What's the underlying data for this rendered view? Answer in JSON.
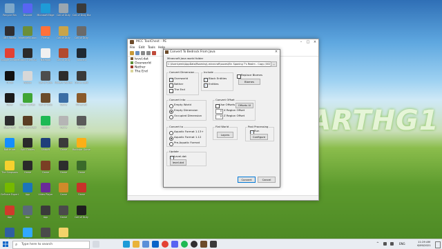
{
  "desktop": {
    "wallpaper_text": "EARTHG1",
    "icons": [
      {
        "label": "Recycle Bin",
        "icon": "recycle-bin-icon",
        "color": "#7da7c9",
        "col": 0,
        "row": 0
      },
      {
        "label": "Discord",
        "icon": "discord-icon",
        "color": "#5865f2",
        "col": 1,
        "row": 0
      },
      {
        "label": "Microsoft Edge",
        "icon": "edge-icon",
        "color": "#1e9bd7",
        "col": 2,
        "row": 0
      },
      {
        "label": "Call of Duty",
        "icon": "game-icon",
        "color": "#9aa6b0",
        "col": 3,
        "row": 0
      },
      {
        "label": "Call of Duty Black Ops",
        "icon": "game-icon",
        "color": "#3a3a3a",
        "col": 4,
        "row": 0
      },
      {
        "label": "OBS Studio",
        "icon": "obs-icon",
        "color": "#302e31",
        "col": 0,
        "row": 1
      },
      {
        "label": "Minecraft Launcher",
        "icon": "minecraft-icon",
        "color": "#6b8e3a",
        "col": 1,
        "row": 1
      },
      {
        "label": "Firefox",
        "icon": "firefox-icon",
        "color": "#ff7139",
        "col": 2,
        "row": 1
      },
      {
        "label": "Call of Duty",
        "icon": "game-icon",
        "color": "#c9a44a",
        "col": 3,
        "row": 1
      },
      {
        "label": "Call of Duty",
        "icon": "game-icon",
        "color": "#6a6a6a",
        "col": 4,
        "row": 1
      },
      {
        "label": "Google Chrome",
        "icon": "chrome-icon",
        "color": "#e34133",
        "col": 0,
        "row": 2
      },
      {
        "label": "Grand Theft Auto V",
        "icon": "gta-icon",
        "color": "#2b2b2b",
        "col": 1,
        "row": 2
      },
      {
        "label": "Notepad",
        "icon": "file-icon",
        "color": "#f0f0f0",
        "col": 2,
        "row": 2
      },
      {
        "label": "Call of Duty",
        "icon": "game-icon",
        "color": "#b24a2e",
        "col": 3,
        "row": 2
      },
      {
        "label": "Valorant",
        "icon": "game-icon",
        "color": "#1f2933",
        "col": 4,
        "row": 2
      },
      {
        "label": "TikTok",
        "icon": "tiktok-icon",
        "color": "#111111",
        "col": 0,
        "row": 3
      },
      {
        "label": "Roblox",
        "icon": "roblox-icon",
        "color": "#d8d8d8",
        "col": 1,
        "row": 3
      },
      {
        "label": "Call of Duty",
        "icon": "game-icon",
        "color": "#4d4d4d",
        "col": 2,
        "row": 3
      },
      {
        "label": "Modern Warfare",
        "icon": "game-icon",
        "color": "#2c2c2c",
        "col": 3,
        "row": 3
      },
      {
        "label": "Dying Light",
        "icon": "game-icon",
        "color": "#3a3a3a",
        "col": 4,
        "row": 3
      },
      {
        "label": "Razer",
        "icon": "razer-icon",
        "color": "#1b1b1b",
        "col": 0,
        "row": 4
      },
      {
        "label": "Razer Cortex",
        "icon": "razer-icon",
        "color": "#3fa535",
        "col": 1,
        "row": 4
      },
      {
        "label": "Call of Duty",
        "icon": "game-icon",
        "color": "#6b4c2b",
        "col": 2,
        "row": 4
      },
      {
        "label": "Game",
        "icon": "game-icon",
        "color": "#3b6ea5",
        "col": 3,
        "row": 4
      },
      {
        "label": "Minecraft",
        "icon": "minecraft-icon",
        "color": "#8a5a2b",
        "col": 4,
        "row": 4
      },
      {
        "label": "Steel Rain",
        "icon": "game-icon",
        "color": "#2d2d2d",
        "col": 0,
        "row": 5
      },
      {
        "label": "MCC ToolChest",
        "icon": "tool-icon",
        "color": "#5a3d22",
        "col": 1,
        "row": 5
      },
      {
        "label": "Spotify",
        "icon": "spotify-icon",
        "color": "#1db954",
        "col": 2,
        "row": 5
      },
      {
        "label": "Game",
        "icon": "game-icon",
        "color": "#b5b5b5",
        "col": 3,
        "row": 5
      },
      {
        "label": "Game",
        "icon": "game-icon",
        "color": "#5a5a5a",
        "col": 4,
        "row": 5
      },
      {
        "label": "Battle.net",
        "icon": "battlenet-icon",
        "color": "#148eff",
        "col": 0,
        "row": 6
      },
      {
        "label": "Epic Games",
        "icon": "epic-icon",
        "color": "#2a2a2a",
        "col": 1,
        "row": 6
      },
      {
        "label": "Ubisoft",
        "icon": "ubisoft-icon",
        "color": "#1f3f7a",
        "col": 2,
        "row": 6
      },
      {
        "label": "Game",
        "icon": "game-icon",
        "color": "#3a3a3a",
        "col": 3,
        "row": 6
      },
      {
        "label": "Rockstar Games",
        "icon": "rockstar-icon",
        "color": "#fcaf17",
        "col": 4,
        "row": 6
      },
      {
        "label": "The Simpsons",
        "icon": "game-icon",
        "color": "#f6d12e",
        "col": 0,
        "row": 7
      },
      {
        "label": "Game",
        "icon": "game-icon",
        "color": "#2a2a2a",
        "col": 1,
        "row": 7
      },
      {
        "label": "Game",
        "icon": "game-icon",
        "color": "#7a3f24",
        "col": 2,
        "row": 7
      },
      {
        "label": "Game",
        "icon": "game-icon",
        "color": "#2d2d2d",
        "col": 3,
        "row": 7
      },
      {
        "label": "Game",
        "icon": "game-icon",
        "color": "#3a6a2a",
        "col": 4,
        "row": 7
      },
      {
        "label": "GeForce Experience",
        "icon": "nvidia-icon",
        "color": "#76b900",
        "col": 0,
        "row": 8
      },
      {
        "label": "App",
        "icon": "app-icon",
        "color": "#1b75bb",
        "col": 1,
        "row": 8
      },
      {
        "label": "Video Player",
        "icon": "video-icon",
        "color": "#6a2a9a",
        "col": 2,
        "row": 8
      },
      {
        "label": "Game",
        "icon": "game-icon",
        "color": "#d08a2a",
        "col": 3,
        "row": 8
      },
      {
        "label": "Game",
        "icon": "game-icon",
        "color": "#c8322a",
        "col": 4,
        "row": 8
      },
      {
        "label": "App",
        "icon": "app-icon",
        "color": "#cf3b2b",
        "col": 0,
        "row": 9
      },
      {
        "label": "App",
        "icon": "app-icon",
        "color": "#5a6a7a",
        "col": 1,
        "row": 9
      },
      {
        "label": "App",
        "icon": "app-icon",
        "color": "#3a3a3a",
        "col": 2,
        "row": 9
      },
      {
        "label": "Game",
        "icon": "game-icon",
        "color": "#4a4a4a",
        "col": 3,
        "row": 9
      },
      {
        "label": "Call of Duty",
        "icon": "game-icon",
        "color": "#1f1f1f",
        "col": 4,
        "row": 9
      },
      {
        "label": "App",
        "icon": "app-icon",
        "color": "#2f5fa0",
        "col": 0,
        "row": 10
      },
      {
        "label": "Photoshop",
        "icon": "photoshop-icon",
        "color": "#31a8ff",
        "col": 1,
        "row": 10
      },
      {
        "label": "App",
        "icon": "app-icon",
        "color": "#4a4a4a",
        "col": 2,
        "row": 10
      },
      {
        "label": "File",
        "icon": "file-icon",
        "color": "#f3d36a",
        "col": 3,
        "row": 10
      }
    ]
  },
  "mcc_window": {
    "title": "MCC ToolChest - PE",
    "menu": [
      "File",
      "Edit",
      "Tools",
      "Help"
    ],
    "tree": [
      "level.dat",
      "Overworld",
      "Nether",
      "The End"
    ]
  },
  "dialog": {
    "title": "Convert To Bedrock From Java",
    "world_folder_label": "Minecraft Java world folder",
    "world_folder_value": "C:\\Users\\emb\\AppData\\Roaming\\.minecraft\\saves\\Ein Spaning T's Realm - Copy (002)\\",
    "browse_label": "...",
    "convert_dimension": {
      "legend": "Convert Dimension",
      "options": [
        {
          "label": "Overworld",
          "checked": true
        },
        {
          "label": "Nether",
          "checked": false
        },
        {
          "label": "The End",
          "checked": false
        }
      ]
    },
    "include": {
      "legend": "Include",
      "options": [
        {
          "label": "Block Entities",
          "checked": true
        },
        {
          "label": "Entities",
          "checked": true
        }
      ]
    },
    "replace_biomes": {
      "label": "Replace Biomes",
      "checked": false,
      "button": "Biomes"
    },
    "convert_into": {
      "legend": "Convert into",
      "options": [
        {
          "label": "Empty World",
          "selected": false
        },
        {
          "label": "Empty Dimension",
          "selected": true
        },
        {
          "label": "Occupied Dimension",
          "selected": false
        }
      ]
    },
    "convert_offset": {
      "legend": "Convert Offset",
      "use_offsets_label": "Use Offsets",
      "use_offsets_checked": false,
      "offsets_button": "Offsets UI",
      "x_value": "0",
      "x_label": "X Region Offset",
      "z_value": "0",
      "z_label": "Z Region Offset"
    },
    "convert_to": {
      "legend": "Convert to",
      "options": [
        {
          "label": "Aquatic Format 1.13+",
          "selected": false
        },
        {
          "label": "Aquatic Format 1.12",
          "selected": true
        },
        {
          "label": "Pre-Aquatic Format",
          "selected": false
        }
      ]
    },
    "flat_world": {
      "legend": "Flat World",
      "button": "Layers"
    },
    "post_processing": {
      "legend": "Post Processing",
      "run_label": "Run",
      "run_checked": true,
      "button": "Configure"
    },
    "update": {
      "legend": "Update",
      "level_label": "Level.dat",
      "level_checked": true,
      "button": "level.dat"
    },
    "convert_button": "Convert",
    "cancel_button": "Cancel"
  },
  "taskbar": {
    "search_placeholder": "Type here to search",
    "time": "11:29 AM",
    "date": "6/09/2021",
    "lang": "ENG"
  }
}
